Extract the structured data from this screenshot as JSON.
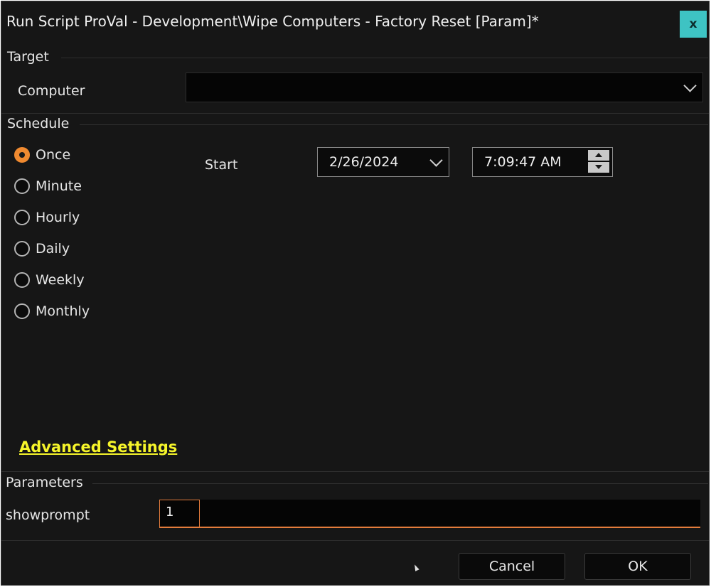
{
  "window": {
    "title": "Run Script ProVal - Development\\Wipe Computers - Factory Reset [Param]*",
    "close_label": "x"
  },
  "target": {
    "section_label": "Target",
    "computer_label": "Computer",
    "computer_value": ""
  },
  "schedule": {
    "section_label": "Schedule",
    "options": [
      {
        "label": "Once",
        "checked": true
      },
      {
        "label": "Minute",
        "checked": false
      },
      {
        "label": "Hourly",
        "checked": false
      },
      {
        "label": "Daily",
        "checked": false
      },
      {
        "label": "Weekly",
        "checked": false
      },
      {
        "label": "Monthly",
        "checked": false
      }
    ],
    "start_label": "Start",
    "start_date": "2/26/2024",
    "start_time": "7:09:47 AM",
    "advanced_link": "Advanced Settings"
  },
  "parameters": {
    "section_label": "Parameters",
    "param_name": "showprompt",
    "param_value": "1"
  },
  "buttons": {
    "cancel": "Cancel",
    "ok": "OK"
  },
  "colors": {
    "accent_orange": "#f08a30",
    "link_yellow": "#f6f52a",
    "close_teal": "#3ec3c3",
    "background": "#161616"
  }
}
